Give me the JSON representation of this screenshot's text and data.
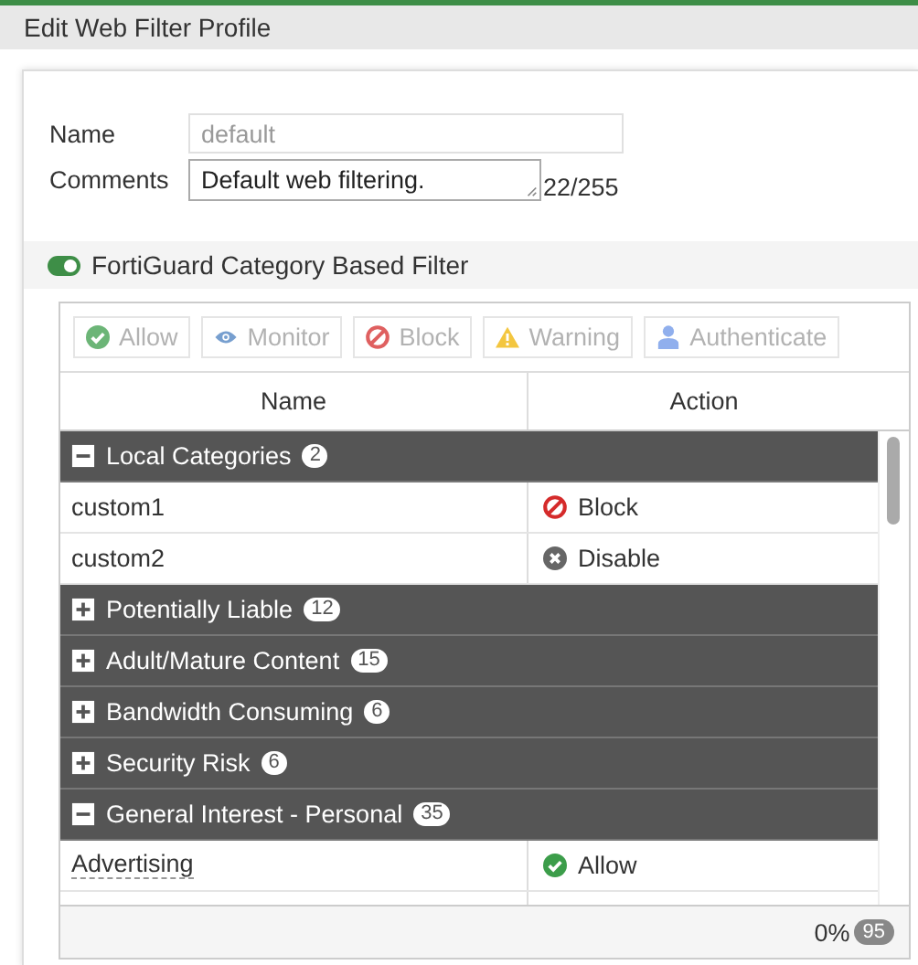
{
  "window": {
    "title": "Edit Web Filter Profile"
  },
  "form": {
    "name_label": "Name",
    "name_value": "default",
    "comments_label": "Comments",
    "comments_value": "Default web filtering.",
    "comments_counter": "22/255"
  },
  "section": {
    "label": "FortiGuard Category Based Filter",
    "on": true
  },
  "toolbar": [
    {
      "kind": "allow",
      "label": "Allow",
      "disabled": true
    },
    {
      "kind": "monitor",
      "label": "Monitor",
      "disabled": true
    },
    {
      "kind": "block",
      "label": "Block",
      "disabled": true
    },
    {
      "kind": "warning",
      "label": "Warning",
      "disabled": true
    },
    {
      "kind": "authenticate",
      "label": "Authenticate",
      "disabled": true
    }
  ],
  "table": {
    "columns": [
      "Name",
      "Action"
    ],
    "groups": [
      {
        "name": "Local Categories",
        "count": "2",
        "expanded": true,
        "children": [
          {
            "name": "custom1",
            "action": "Block",
            "kind": "block"
          },
          {
            "name": "custom2",
            "action": "Disable",
            "kind": "disable"
          }
        ]
      },
      {
        "name": "Potentially Liable",
        "count": "12",
        "expanded": false
      },
      {
        "name": "Adult/Mature Content",
        "count": "15",
        "expanded": false
      },
      {
        "name": "Bandwidth Consuming",
        "count": "6",
        "expanded": false
      },
      {
        "name": "Security Risk",
        "count": "6",
        "expanded": false
      },
      {
        "name": "General Interest - Personal",
        "count": "35",
        "expanded": true,
        "children": [
          {
            "name": "Advertising",
            "action": "Allow",
            "kind": "allow"
          }
        ]
      }
    ],
    "footer": {
      "percent": "0%",
      "count": "95"
    }
  }
}
